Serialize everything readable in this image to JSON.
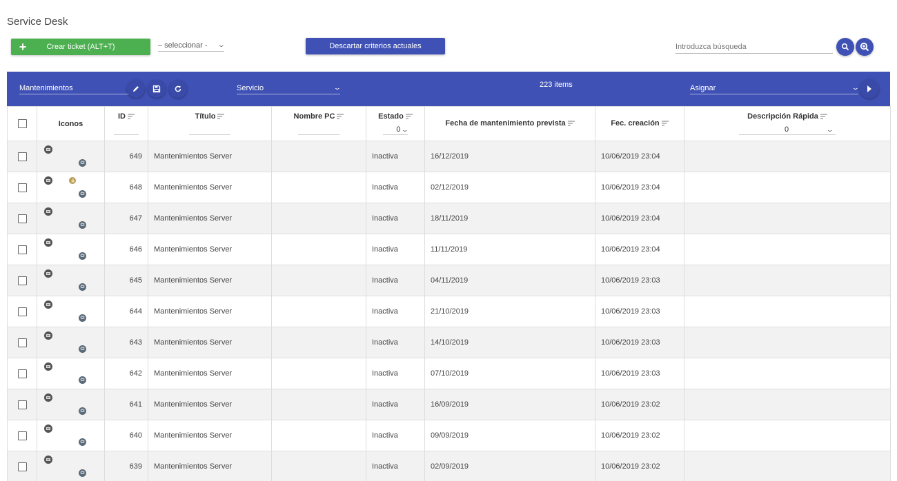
{
  "page": {
    "title": "Service Desk"
  },
  "topbar": {
    "create_button": {
      "icon": "plus-icon",
      "label": "Crear ticket (ALT+T)"
    },
    "select_value": "– seleccionar -",
    "discard_button": "Descartar criterios actuales",
    "search": {
      "placeholder": "Introduzca búsqueda",
      "value": ""
    },
    "search_button_icon": "search-icon",
    "advanced_search_icon": "zoom-in-icon"
  },
  "toolbar": {
    "view_select": "Mantenimientos",
    "edit_icon": "pencil-icon",
    "save_icon": "floppy-icon",
    "refresh_icon": "refresh-icon",
    "service_select": "Servicio",
    "items_count": "223 items",
    "assign_select": "Asignar",
    "next_icon": "play-icon"
  },
  "colors": {
    "primary": "#3f51b5",
    "success": "#4caf50",
    "row_alt": "#f2f2f2"
  },
  "table": {
    "columns": {
      "icons": "Iconos",
      "id": "ID",
      "title": "Título",
      "pc_name": "Nombre PC",
      "status": "Estado",
      "status_filter": "0",
      "planned_date": "Fecha de mantenimiento prevista",
      "created": "Fec. creación",
      "quick_desc": "Descripción Rápida",
      "quick_desc_filter": "0"
    },
    "rows": [
      {
        "id": "649",
        "title": "Mantenimientos Server",
        "pc": "",
        "status": "Inactiva",
        "planned": "16/12/2019",
        "created": "10/06/2019 23:04",
        "desc": "",
        "lock": false
      },
      {
        "id": "648",
        "title": "Mantenimientos Server",
        "pc": "",
        "status": "Inactiva",
        "planned": "02/12/2019",
        "created": "10/06/2019 23:04",
        "desc": "",
        "lock": true
      },
      {
        "id": "647",
        "title": "Mantenimientos Server",
        "pc": "",
        "status": "Inactiva",
        "planned": "18/11/2019",
        "created": "10/06/2019 23:04",
        "desc": "",
        "lock": false
      },
      {
        "id": "646",
        "title": "Mantenimientos Server",
        "pc": "",
        "status": "Inactiva",
        "planned": "11/11/2019",
        "created": "10/06/2019 23:04",
        "desc": "",
        "lock": false
      },
      {
        "id": "645",
        "title": "Mantenimientos Server",
        "pc": "",
        "status": "Inactiva",
        "planned": "04/11/2019",
        "created": "10/06/2019 23:03",
        "desc": "",
        "lock": false
      },
      {
        "id": "644",
        "title": "Mantenimientos Server",
        "pc": "",
        "status": "Inactiva",
        "planned": "21/10/2019",
        "created": "10/06/2019 23:03",
        "desc": "",
        "lock": false
      },
      {
        "id": "643",
        "title": "Mantenimientos Server",
        "pc": "",
        "status": "Inactiva",
        "planned": "14/10/2019",
        "created": "10/06/2019 23:03",
        "desc": "",
        "lock": false
      },
      {
        "id": "642",
        "title": "Mantenimientos Server",
        "pc": "",
        "status": "Inactiva",
        "planned": "07/10/2019",
        "created": "10/06/2019 23:03",
        "desc": "",
        "lock": false
      },
      {
        "id": "641",
        "title": "Mantenimientos Server",
        "pc": "",
        "status": "Inactiva",
        "planned": "16/09/2019",
        "created": "10/06/2019 23:02",
        "desc": "",
        "lock": false
      },
      {
        "id": "640",
        "title": "Mantenimientos Server",
        "pc": "",
        "status": "Inactiva",
        "planned": "09/09/2019",
        "created": "10/06/2019 23:02",
        "desc": "",
        "lock": false
      },
      {
        "id": "639",
        "title": "Mantenimientos Server",
        "pc": "",
        "status": "Inactiva",
        "planned": "02/09/2019",
        "created": "10/06/2019 23:02",
        "desc": "",
        "lock": false
      }
    ],
    "ci_badge": "CI"
  }
}
